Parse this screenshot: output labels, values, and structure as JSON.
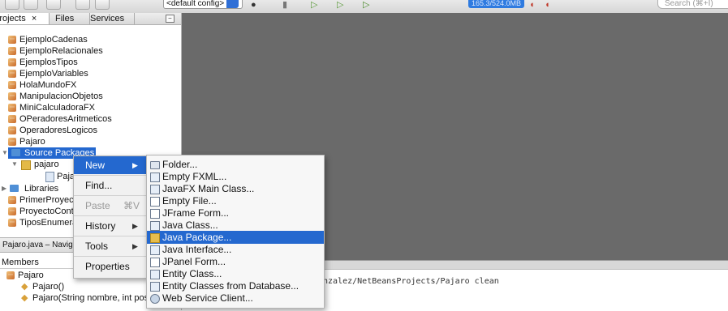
{
  "toolbar": {
    "config_select": "<default config>",
    "memory": "165.3/524.0MB",
    "search_placeholder": "Search (⌘+I)"
  },
  "tabs": {
    "projects": "Projects",
    "close": "×",
    "files": "Files",
    "services": "Services",
    "minimize": "–"
  },
  "tree": {
    "projects": [
      "EjemploCadenas",
      "EjemploRelacionales",
      "EjemplosTipos",
      "EjemploVariables",
      "HolaMundoFX",
      "ManipulacionObjetos",
      "MiniCalculadoraFX",
      "OPeradoresAritmeticos",
      "OperadoresLogicos",
      "Pajaro"
    ],
    "source_packages": "Source Packages",
    "package": "pajaro",
    "file": "Pajaro.java",
    "libraries": "Libraries",
    "more_projects": [
      "PrimerProyecto",
      "ProyectoControl",
      "TiposEnumerados"
    ]
  },
  "navigator": {
    "title": "Pajaro.java – Navigator",
    "members": "Members",
    "class_name": "Pajaro",
    "constructor1": "Pajaro()",
    "constructor2": "Pajaro(String nombre, int pos)"
  },
  "output": {
    "line": "onzalez/NetBeansProjects/Pajaro clean"
  },
  "context_menu": {
    "new": "New",
    "find": "Find...",
    "paste": "Paste",
    "paste_shortcut": "⌘V",
    "history": "History",
    "tools": "Tools",
    "properties": "Properties"
  },
  "new_submenu": {
    "items": [
      "Folder...",
      "Empty FXML...",
      "JavaFX Main Class...",
      "Empty File...",
      "JFrame Form...",
      "Java Class...",
      "Java Package...",
      "Java Interface...",
      "JPanel Form...",
      "Entity Class...",
      "Entity Classes from Database...",
      "Web Service Client..."
    ],
    "active_index": 6
  },
  "colors": {
    "selection": "#2468cf",
    "editor_bg": "#6a6a6a"
  }
}
